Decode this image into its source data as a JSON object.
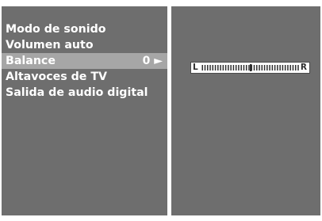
{
  "menu": {
    "items": [
      {
        "label": "Modo de sonido",
        "value": ""
      },
      {
        "label": "Volumen auto",
        "value": ""
      },
      {
        "label": "Balance",
        "value": "0 ►",
        "selected": true
      },
      {
        "label": "Altavoces de TV",
        "value": ""
      },
      {
        "label": "Salida de audio digital",
        "value": ""
      }
    ]
  },
  "balance": {
    "left_label": "L",
    "right_label": "R",
    "value": 0,
    "range": [
      -50,
      50
    ]
  },
  "colors": {
    "panel": "#6e6e6e",
    "highlight": "#a6a6a6",
    "text": "#ffffff"
  }
}
